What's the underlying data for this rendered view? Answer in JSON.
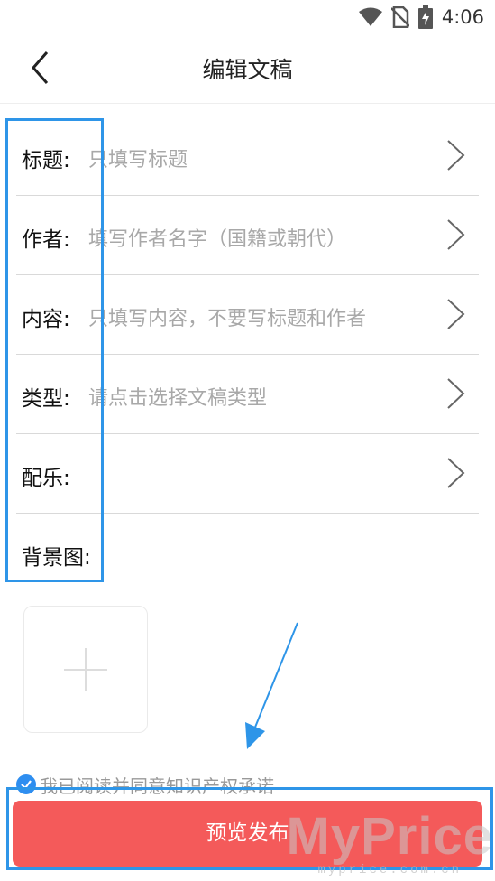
{
  "status_bar": {
    "time": "4:06",
    "icons": [
      "wifi-icon",
      "no-sim-icon",
      "battery-charging-icon"
    ]
  },
  "header": {
    "title": "编辑文稿",
    "back_icon": "chevron-left-icon"
  },
  "form": {
    "rows": [
      {
        "label": "标题:",
        "placeholder": "只填写标题",
        "has_arrow": true
      },
      {
        "label": "作者:",
        "placeholder": "填写作者名字（国籍或朝代）",
        "has_arrow": true
      },
      {
        "label": "内容:",
        "placeholder": "只填写内容，不要写标题和作者",
        "has_arrow": true
      },
      {
        "label": "类型:",
        "placeholder": "请点击选择文稿类型",
        "has_arrow": true
      },
      {
        "label": "配乐:",
        "placeholder": "",
        "has_arrow": true
      },
      {
        "label": "背景图:",
        "placeholder": "",
        "has_arrow": false
      }
    ],
    "add_image_icon": "plus-icon"
  },
  "agreement": {
    "text": "我已阅读并同意知识产权承诺",
    "checked": true
  },
  "submit": {
    "label": "预览发布"
  },
  "watermark": {
    "main": "MyPrice",
    "sub": "myprice.com.cn"
  },
  "colors": {
    "accent_red": "#f45a5a",
    "annotation_blue": "#2e95e8",
    "check_blue": "#2e8ef0"
  }
}
